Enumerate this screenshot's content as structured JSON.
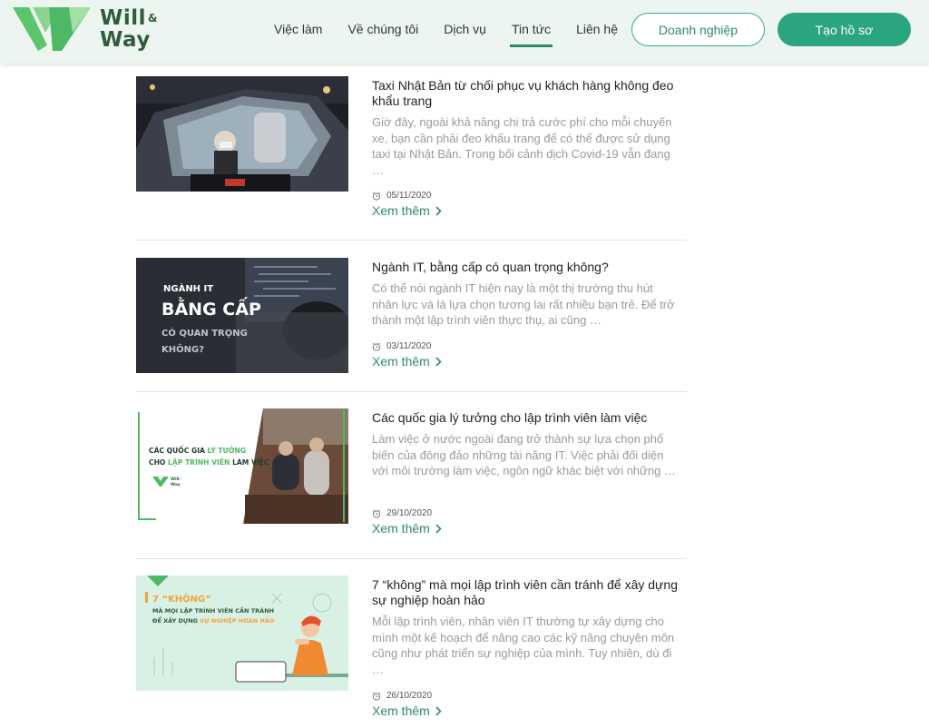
{
  "brand": {
    "name_line1": "Will",
    "amp": "&",
    "name_line2": "Way",
    "color": "#2f5c3a",
    "accent": "#5cc46c"
  },
  "nav": {
    "items": [
      {
        "label": "Việc làm"
      },
      {
        "label": "Về chúng tôi"
      },
      {
        "label": "Dịch vụ"
      },
      {
        "label": "Tin tức",
        "active": true
      },
      {
        "label": "Liên hệ"
      }
    ],
    "enterprise_button": "Doanh nghiệp",
    "create_profile_button": "Tạo hồ sơ"
  },
  "articles": [
    {
      "title": "Taxi Nhật Bản từ chối phục vụ khách hàng không đeo khẩu trang",
      "excerpt": "Giờ đây, ngoài khả năng chi trả cước phí cho mỗi chuyến xe, bạn cần phải đeo khẩu trang để có thể được sử dụng taxi tại Nhật Bản. Trong bối cảnh dịch Covid-19 vẫn đang …",
      "date": "05/11/2020",
      "more": "Xem thêm",
      "thumb_text": [
        "",
        ""
      ]
    },
    {
      "title": "Ngành IT, bằng cấp có quan trọng không?",
      "excerpt": "Có thể nói ngành IT hiện nay là một thị trường thu hút nhân lực và là lựa chọn tương lai rất nhiều bạn trẻ. Để trở thành một lập trình viên thực thụ, ai cũng …",
      "date": "03/11/2020",
      "more": "Xem thêm",
      "thumb_text": [
        "NGÀNH IT",
        "BẰNG CẤP",
        "CÓ QUAN TRỌNG",
        "KHÔNG?"
      ]
    },
    {
      "title": "Các quốc gia lý tưởng cho lập trình viên làm việc",
      "excerpt": "Làm việc ở nước ngoài đang trở thành sự lựa chọn phổ biến của đông đảo những tài năng IT. Việc phải đối diện với môi trường làm việc, ngôn ngữ khác biệt với những …",
      "date": "29/10/2020",
      "more": "Xem thêm",
      "thumb_text": [
        "CÁC QUỐC GIA ",
        "LÝ TƯỞNG",
        "CHO ",
        "LẬP TRÌNH VIÊN",
        " LÀM VIỆC",
        "Will-",
        "Way"
      ]
    },
    {
      "title": "7 “không” mà mọi lập trình viên cần tránh để xây dựng sự nghiệp hoàn hảo",
      "excerpt": "Mỗi lập trình viên, nhân viên IT thường tự xây dựng cho mình một kế hoạch để nâng cao các kỹ năng chuyên môn cũng như phát triển sự nghiệp của mình. Tuy nhiên, dù đi …",
      "date": "26/10/2020",
      "more": "Xem thêm",
      "thumb_text": [
        "7 “KHÔNG”",
        "MÀ MỌI LẬP TRÌNH VIÊN CẦN TRÁNH",
        "ĐỂ XÂY DỰNG ",
        "SỰ NGHIỆP HOÀN HẢO"
      ]
    }
  ]
}
